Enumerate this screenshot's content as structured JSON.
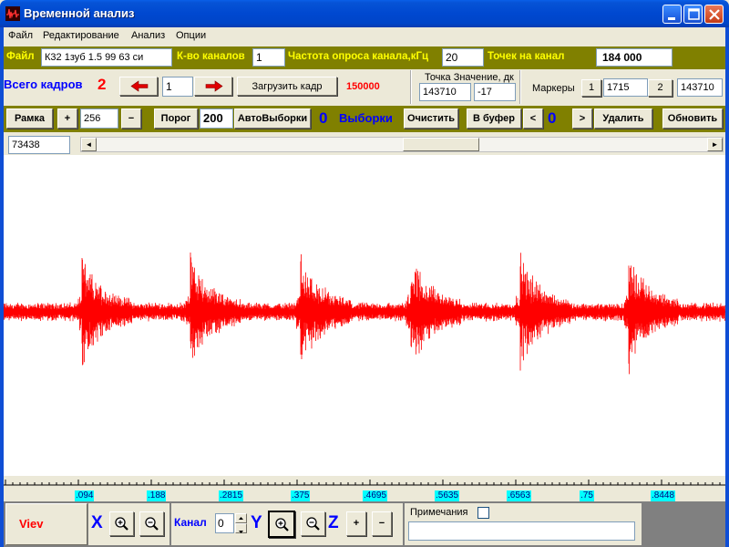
{
  "window": {
    "title": "Временной анализ"
  },
  "menu": [
    "Файл",
    "Редактирование",
    "Анализ",
    "Опции"
  ],
  "row1": {
    "file_label": "Файл",
    "file_value": "К32   1зуб 1.5   99   63   си",
    "channels_label": "К-во каналов",
    "channels_value": "1",
    "rate_label": "Частота опроса канала,кГц",
    "rate_value": "20",
    "points_label": "Точек на канал",
    "points_value": "184 000"
  },
  "row2": {
    "frames_label": "Всего кадров",
    "frames_value": "2",
    "frame_input": "1",
    "load_button": "Загрузить кадр",
    "load_count": "150000",
    "point_header": "Точка  Значение, дк",
    "point_value": "143710",
    "value_value": "-17",
    "markers_label": "Маркеры",
    "marker1_btn": "1",
    "marker1_value": "1715",
    "marker2_btn": "2",
    "marker2_value": "143710"
  },
  "row3": {
    "frame_btn": "Рамка",
    "plus": "+",
    "frame_value": "256",
    "minus": "−",
    "threshold_btn": "Порог",
    "threshold_value": "200",
    "auto_btn": "АвтоВыборки",
    "count_a": "0",
    "samples_label": "Выборки",
    "clear_btn": "Очистить",
    "buffer_btn": "В буфер",
    "prev": "<",
    "count_b": "0",
    "next": ">",
    "delete_btn": "Удалить",
    "refresh_btn": "Обновить"
  },
  "scroll": {
    "position_value": "73438",
    "left_arrow": "◄",
    "right_arrow": "►"
  },
  "ruler": {
    "ticks": [
      ".094",
      ".188",
      ".2815",
      ".375",
      ".4695",
      ".5635",
      ".6563",
      ".75",
      ".8448"
    ]
  },
  "bottom": {
    "viev": "Viev",
    "x_label": "X",
    "channel_label": "Канал",
    "channel_value": "0",
    "y_label": "Y",
    "z_label": "Z",
    "z_plus": "+",
    "z_minus": "−",
    "notes_label": "Примечания"
  },
  "colors": {
    "signal": "#FF0000",
    "olive": "#808000",
    "label_yellow": "#FFFF00",
    "accent_blue": "#0000FF"
  }
}
